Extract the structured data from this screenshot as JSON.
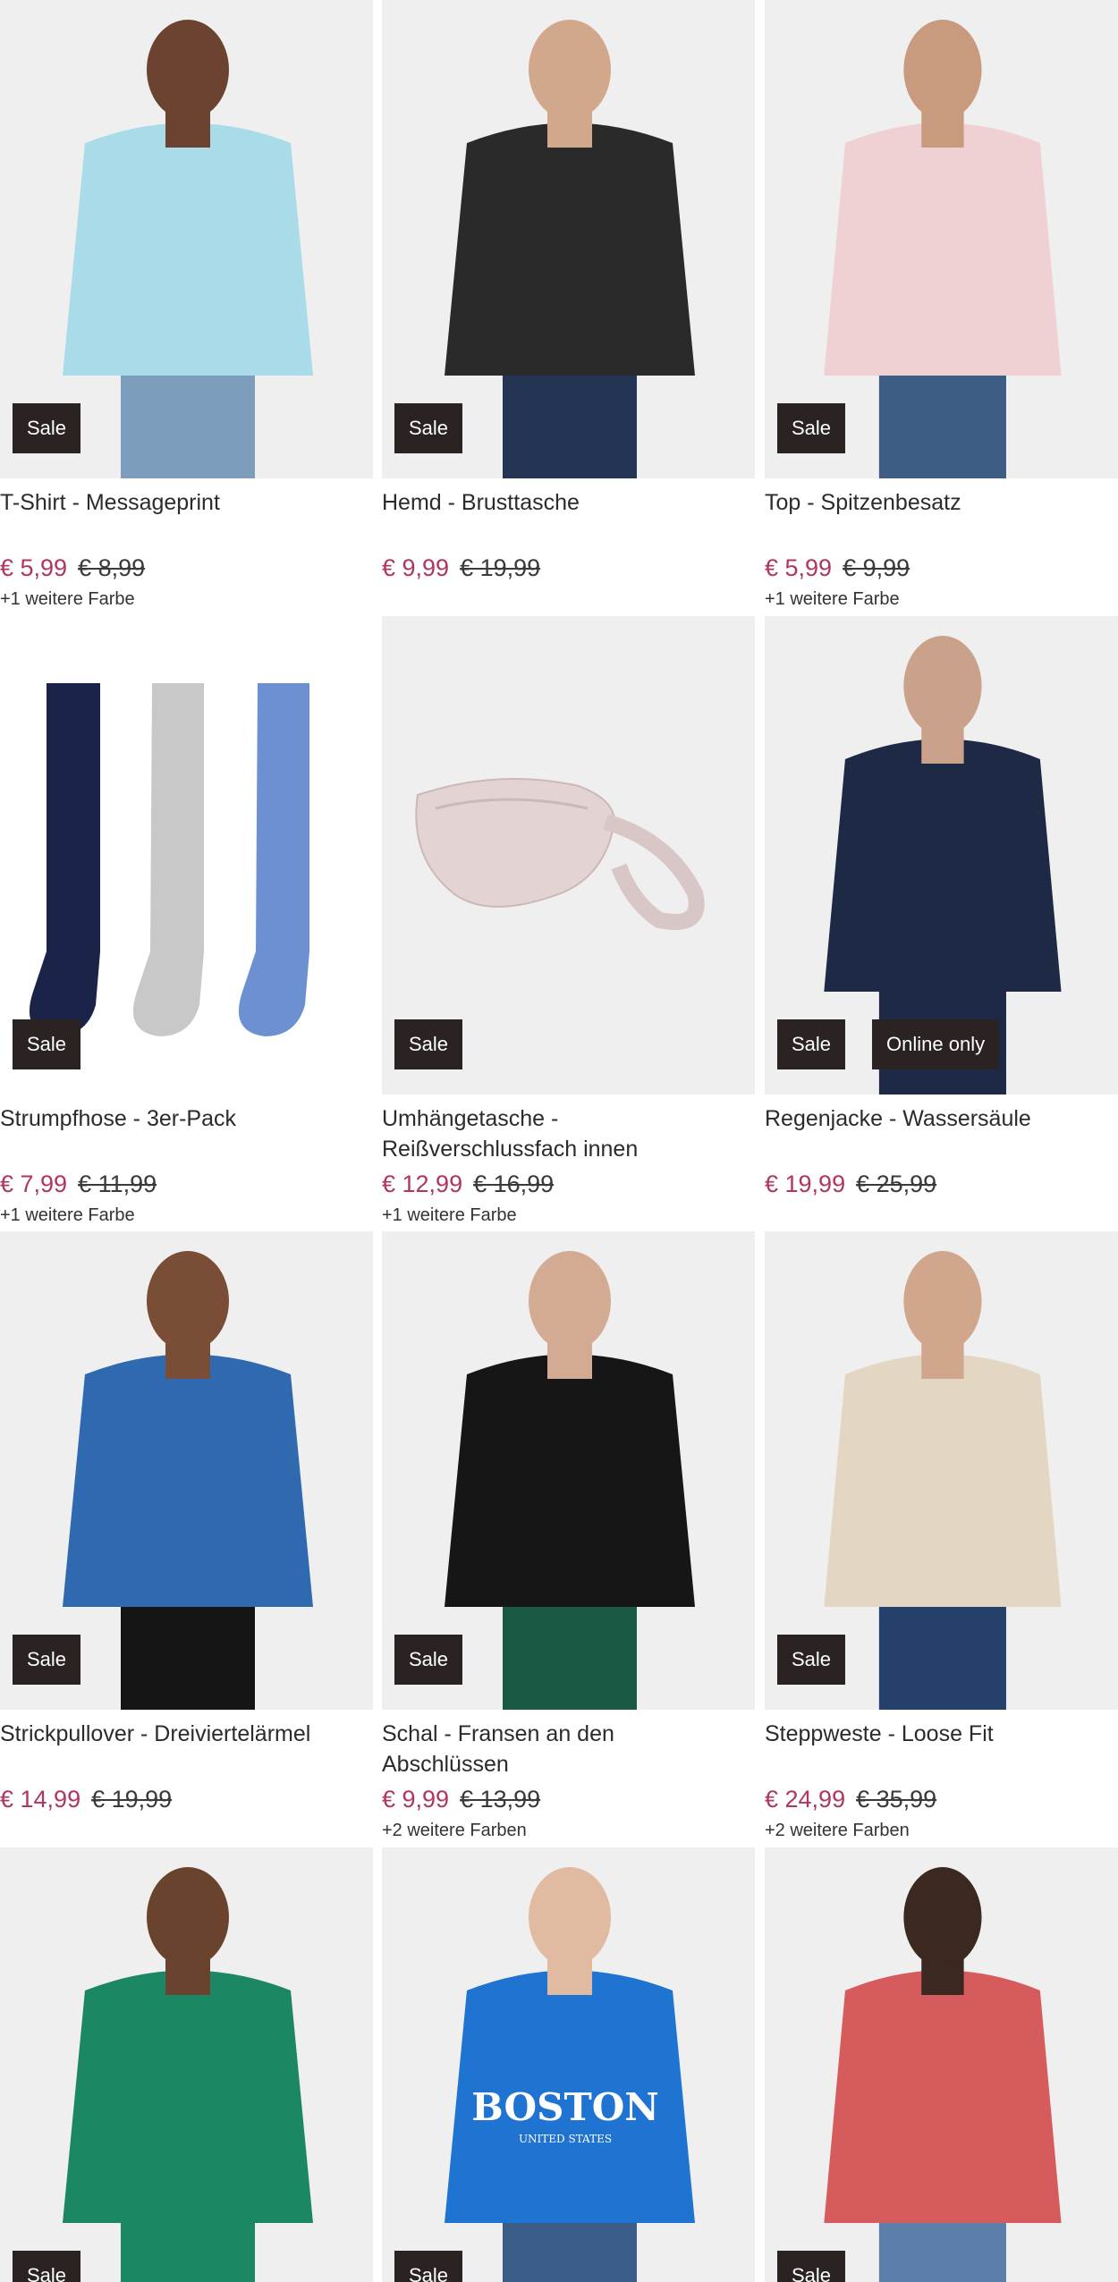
{
  "currency": "€",
  "badges": {
    "sale": "Sale",
    "online_only": "Online only"
  },
  "products": [
    {
      "title": "T-Shirt - Messageprint",
      "price": "€ 5,99",
      "old_price": "€ 8,99",
      "colors": "+1 weitere Farbe",
      "online_only": false,
      "palette": {
        "bg": "#efefef",
        "main": "#a9dce8",
        "skin": "#6b4330",
        "bottom": "#7d9dbd"
      }
    },
    {
      "title": "Hemd - Brusttasche",
      "price": "€ 9,99",
      "old_price": "€ 19,99",
      "colors": "",
      "online_only": false,
      "palette": {
        "bg": "#efefef",
        "main": "#2a2a2a",
        "skin": "#d2a88c",
        "bottom": "#233454"
      }
    },
    {
      "title": "Top - Spitzenbesatz",
      "price": "€ 5,99",
      "old_price": "€ 9,99",
      "colors": "+1 weitere Farbe",
      "online_only": false,
      "palette": {
        "bg": "#efefef",
        "main": "#efd0d3",
        "skin": "#c99b7e",
        "bottom": "#3d5d85"
      }
    },
    {
      "title": "Strumpfhose - 3er-Pack",
      "price": "€ 7,99",
      "old_price": "€ 11,99",
      "colors": "+1 weitere Farbe",
      "online_only": false,
      "palette": {
        "bg": "#ffffff",
        "main": "#1b2348",
        "skin": "#c8c8c8",
        "bottom": "#6d90d1"
      }
    },
    {
      "title": "Umhängetasche - Reißverschlussfach innen",
      "price": "€ 12,99",
      "old_price": "€ 16,99",
      "colors": "+1 weitere Farbe",
      "online_only": false,
      "palette": {
        "bg": "#efefef",
        "main": "#e3d4d3",
        "skin": "#c9b5b4",
        "bottom": "#d8c7c6"
      }
    },
    {
      "title": "Regenjacke - Wassersäule",
      "price": "€ 19,99",
      "old_price": "€ 25,99",
      "colors": "",
      "online_only": true,
      "palette": {
        "bg": "#efefef",
        "main": "#1e2a45",
        "skin": "#caa18a",
        "bottom": "#1e2a45"
      }
    },
    {
      "title": "Strickpullover - Dreiviertelärmel",
      "price": "€ 14,99",
      "old_price": "€ 19,99",
      "colors": "",
      "online_only": false,
      "palette": {
        "bg": "#efefef",
        "main": "#2f6ab0",
        "skin": "#7a4d36",
        "bottom": "#141414"
      }
    },
    {
      "title": "Schal - Fransen an den Abschlüssen",
      "price": "€ 9,99",
      "old_price": "€ 13,99",
      "colors": "+2 weitere Farben",
      "online_only": false,
      "palette": {
        "bg": "#efefef",
        "main": "#161616",
        "skin": "#d3aa92",
        "bottom": "#1a5a45"
      }
    },
    {
      "title": "Steppweste - Loose Fit",
      "price": "€ 24,99",
      "old_price": "€ 35,99",
      "colors": "+2 weitere Farben",
      "online_only": false,
      "palette": {
        "bg": "#efefef",
        "main": "#e3d6c3",
        "skin": "#d0a68c",
        "bottom": "#25416b"
      }
    },
    {
      "title": "",
      "price": "",
      "old_price": "",
      "colors": "",
      "online_only": false,
      "palette": {
        "bg": "#efefef",
        "main": "#1c8763",
        "skin": "#6a432e",
        "bottom": "#1c8763"
      }
    },
    {
      "title": "",
      "price": "",
      "old_price": "",
      "colors": "",
      "online_only": false,
      "palette": {
        "bg": "#efefef",
        "main": "#1f73d1",
        "skin": "#e0bba2",
        "bottom": "#3b5d88"
      }
    },
    {
      "title": "",
      "price": "",
      "old_price": "",
      "colors": "",
      "online_only": false,
      "palette": {
        "bg": "#efefef",
        "main": "#d65b5d",
        "skin": "#3b2820",
        "bottom": "#5b7fa8"
      }
    }
  ],
  "print_texts": {
    "boston": "BOSTON",
    "boston_sub": "UNITED STATES"
  }
}
